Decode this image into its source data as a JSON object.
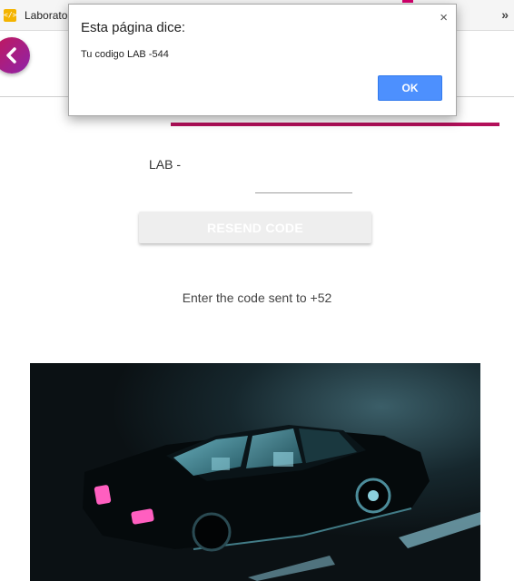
{
  "browser": {
    "tab_title": "Laborato",
    "overflow_label": "»"
  },
  "dialog": {
    "title": "Esta página dice:",
    "close_label": "×",
    "message": "Tu codigo LAB -544",
    "ok_label": "OK"
  },
  "form": {
    "code_prefix": "LAB -",
    "code_value": "",
    "resend_label": "RESEND CODE",
    "sent_text": "Enter the code sent to +52"
  },
  "colors": {
    "accent": "#b3105a",
    "button_primary": "#4d90fe"
  },
  "icons": {
    "back": "chevron-left-icon",
    "favicon": "code-icon"
  }
}
